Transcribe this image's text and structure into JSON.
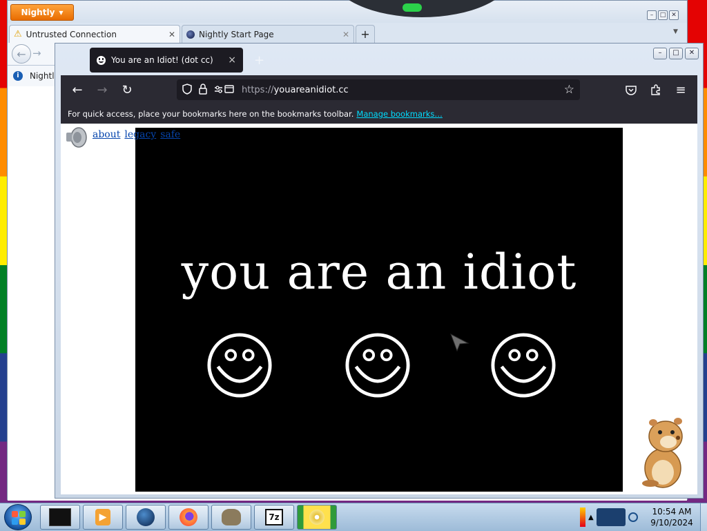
{
  "back_window": {
    "app_button_label": "Nightly",
    "tabs": [
      {
        "label": "Untrusted Connection",
        "icon": "warning-icon"
      },
      {
        "label": "Nightly Start Page",
        "icon": "nightly-globe-icon"
      }
    ],
    "new_tab_label": "+",
    "bookmark_label": "Nightly"
  },
  "front_window": {
    "tab_title": "You are an Idiot! (dot cc)",
    "tab_close": "×",
    "url_scheme": "https://",
    "url_host": "youareanidiot.cc",
    "bookmarks_message": "For quick access, place your bookmarks here on the bookmarks toolbar.",
    "manage_bookmarks_link": "Manage bookmarks…",
    "page": {
      "links": [
        "about",
        "legacy",
        "safe"
      ],
      "headline": "you are an idiot"
    }
  },
  "taskbar": {
    "clock_time": "10:54 AM",
    "clock_date": "9/10/2024",
    "pinned_icons": [
      "terminal-icon",
      "media-player-icon",
      "globe-icon",
      "firefox-icon",
      "gimp-icon",
      "7zip-icon",
      "disc-icon"
    ]
  },
  "colors": {
    "front_toolbar": "#2b2a33",
    "link_accent": "#00ddff",
    "nightly_orange": "#f07800"
  }
}
